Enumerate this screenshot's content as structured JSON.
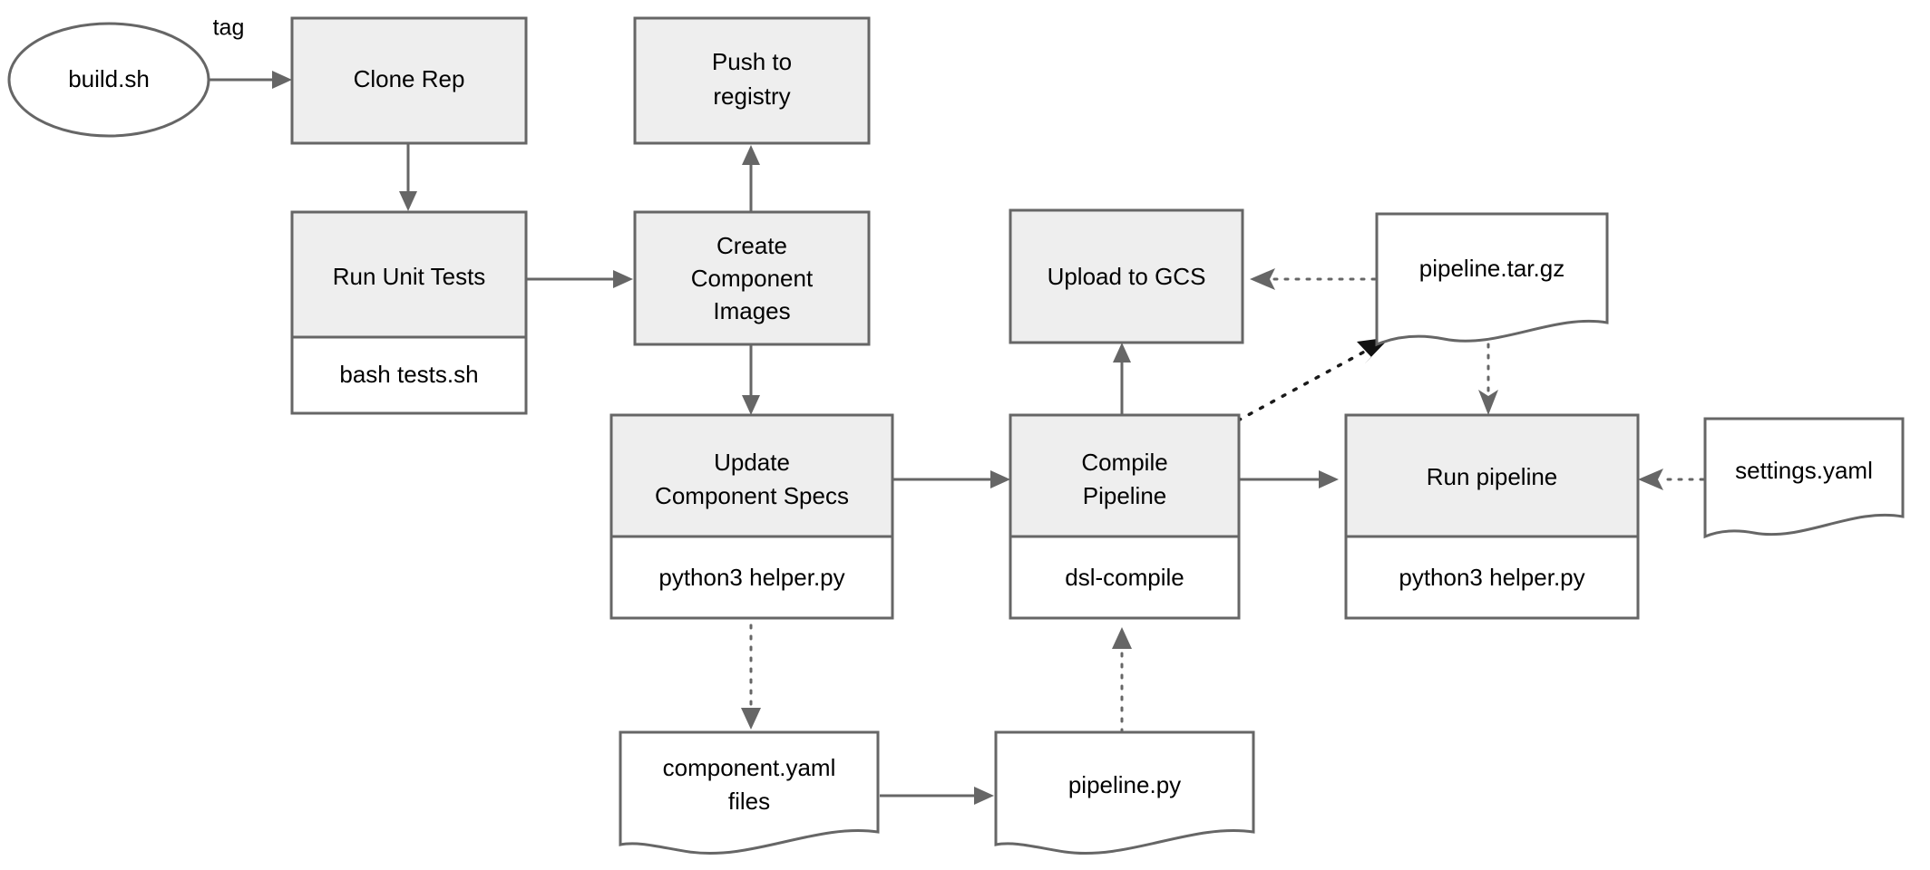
{
  "diagram": {
    "title": "CI/CD build pipeline flowchart",
    "colors": {
      "process_fill": "#eeeeee",
      "command_fill": "#ffffff",
      "document_fill": "#ffffff",
      "stroke": "#666666",
      "text": "#000000",
      "dark_stroke": "#111111",
      "background": "#ffffff"
    },
    "nodes": {
      "build_sh": {
        "label": "build.sh",
        "shape": "ellipse"
      },
      "clone_rep": {
        "label": "Clone Rep",
        "shape": "process"
      },
      "run_unit_tests": {
        "label": "Run Unit Tests",
        "shape": "process"
      },
      "run_unit_tests_cmd": {
        "label": "bash tests.sh",
        "shape": "command"
      },
      "push_to_registry": {
        "label": "Push to registry",
        "line1": "Push to",
        "line2": "registry",
        "shape": "process"
      },
      "create_component_images": {
        "label": "Create Component Images",
        "line1": "Create",
        "line2": "Component",
        "line3": "Images",
        "shape": "process"
      },
      "update_component_specs": {
        "label": "Update Component Specs",
        "line1": "Update",
        "line2": "Component Specs",
        "shape": "process"
      },
      "update_component_specs_cmd": {
        "label": "python3 helper.py",
        "shape": "command"
      },
      "upload_to_gcs": {
        "label": "Upload to GCS",
        "shape": "process"
      },
      "compile_pipeline": {
        "label": "Compile Pipeline",
        "line1": "Compile",
        "line2": "Pipeline",
        "shape": "process"
      },
      "compile_pipeline_cmd": {
        "label": "dsl-compile",
        "shape": "command"
      },
      "run_pipeline": {
        "label": "Run pipeline",
        "shape": "process"
      },
      "run_pipeline_cmd": {
        "label": "python3 helper.py",
        "shape": "command"
      },
      "pipeline_targz": {
        "label": "pipeline.tar.gz",
        "shape": "document"
      },
      "settings_yaml": {
        "label": "settings.yaml",
        "shape": "document"
      },
      "component_yaml_files": {
        "label": "component.yaml files",
        "line1": "component.yaml",
        "line2": "files",
        "shape": "document"
      },
      "pipeline_py": {
        "label": "pipeline.py",
        "shape": "document"
      }
    },
    "edge_labels": {
      "tag": "tag"
    },
    "edges": [
      {
        "from": "build_sh",
        "to": "clone_rep",
        "style": "solid",
        "label": "tag"
      },
      {
        "from": "clone_rep",
        "to": "run_unit_tests",
        "style": "solid",
        "label": ""
      },
      {
        "from": "run_unit_tests",
        "to": "create_component_images",
        "style": "solid",
        "label": ""
      },
      {
        "from": "create_component_images",
        "to": "push_to_registry",
        "style": "solid",
        "label": ""
      },
      {
        "from": "create_component_images",
        "to": "update_component_specs",
        "style": "solid",
        "label": ""
      },
      {
        "from": "update_component_specs",
        "to": "compile_pipeline",
        "style": "solid",
        "label": ""
      },
      {
        "from": "compile_pipeline",
        "to": "upload_to_gcs",
        "style": "solid",
        "label": ""
      },
      {
        "from": "compile_pipeline",
        "to": "run_pipeline",
        "style": "solid",
        "label": ""
      },
      {
        "from": "update_component_specs",
        "to": "component_yaml_files",
        "style": "dotted",
        "label": ""
      },
      {
        "from": "component_yaml_files",
        "to": "pipeline_py",
        "style": "solid",
        "label": ""
      },
      {
        "from": "pipeline_py",
        "to": "compile_pipeline",
        "style": "dotted",
        "label": ""
      },
      {
        "from": "compile_pipeline",
        "to": "pipeline_targz",
        "style": "dotted",
        "label": ""
      },
      {
        "from": "pipeline_targz",
        "to": "upload_to_gcs",
        "style": "dotted",
        "label": ""
      },
      {
        "from": "pipeline_targz",
        "to": "run_pipeline",
        "style": "dotted",
        "label": ""
      },
      {
        "from": "settings_yaml",
        "to": "run_pipeline",
        "style": "dotted",
        "label": ""
      }
    ]
  }
}
